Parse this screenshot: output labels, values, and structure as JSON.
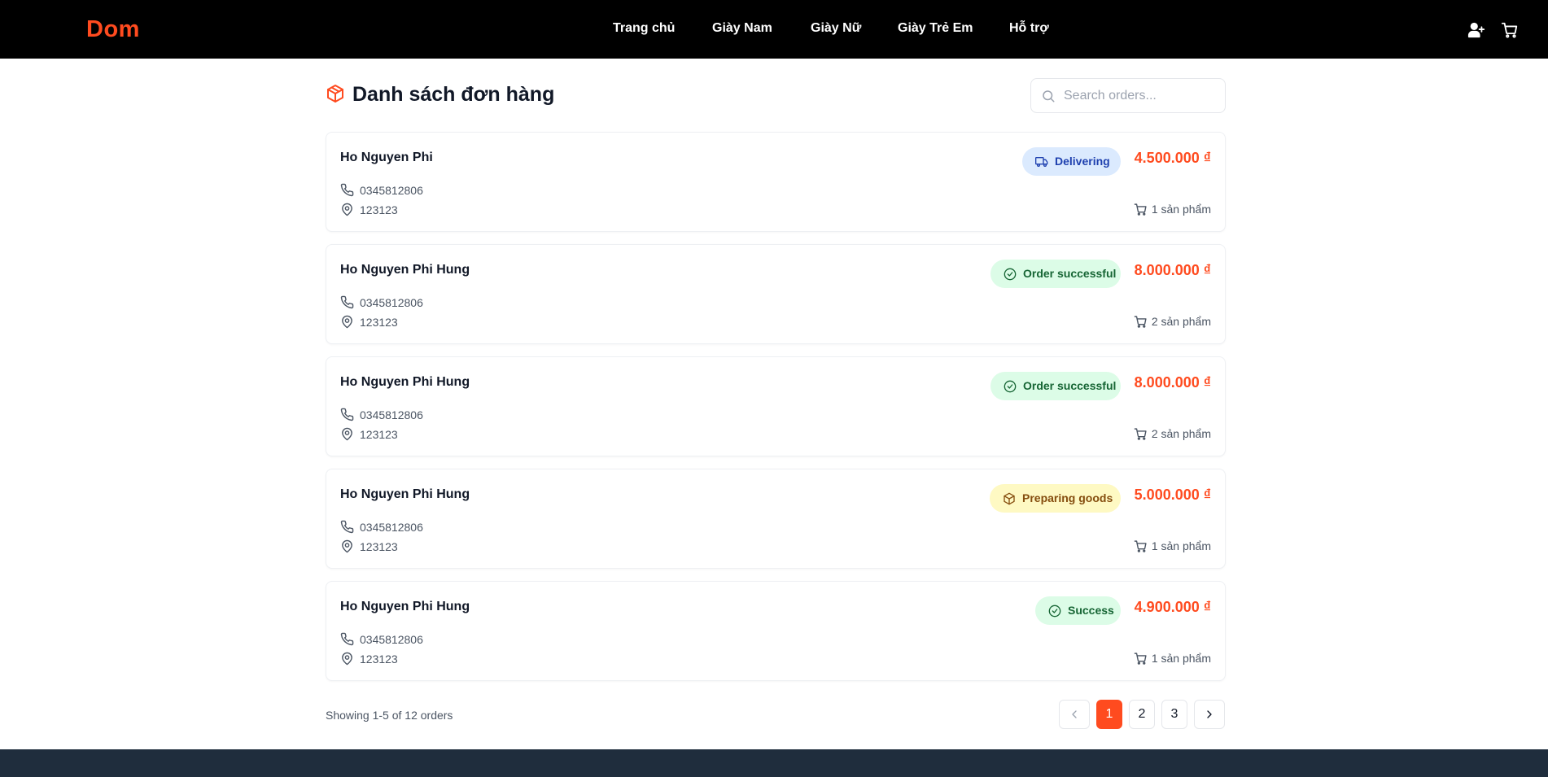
{
  "brand": {
    "logo": "Dom",
    "accent_color": "#ff4b1f"
  },
  "nav": {
    "items": [
      "Trang chủ",
      "Giày Nam",
      "Giày Nữ",
      "Giày Trẻ Em",
      "Hỗ trợ"
    ],
    "icons": [
      "user-plus-icon",
      "cart-icon"
    ]
  },
  "page": {
    "title": "Danh sách đơn hàng",
    "title_icon": "package-icon",
    "search_placeholder": "Search orders...",
    "search_value": ""
  },
  "orders": [
    {
      "name": "Ho Nguyen Phi",
      "phone": "0345812806",
      "address": "123123",
      "status": "Delivering",
      "status_icon": "truck-icon",
      "status_bg": "#dbeafe",
      "status_color": "#1e40af",
      "amount": "4.500.000 ₫",
      "items": "1 sản phẩm"
    },
    {
      "name": "Ho Nguyen Phi Hung",
      "phone": "0345812806",
      "address": "123123",
      "status": "Order successful",
      "status_icon": "check-circle-icon",
      "status_bg": "#dcfce7",
      "status_color": "#166534",
      "amount": "8.000.000 ₫",
      "items": "2 sản phẩm"
    },
    {
      "name": "Ho Nguyen Phi Hung",
      "phone": "0345812806",
      "address": "123123",
      "status": "Order successful",
      "status_icon": "check-circle-icon",
      "status_bg": "#dcfce7",
      "status_color": "#166534",
      "amount": "8.000.000 ₫",
      "items": "2 sản phẩm"
    },
    {
      "name": "Ho Nguyen Phi Hung",
      "phone": "0345812806",
      "address": "123123",
      "status": "Preparing goods",
      "status_icon": "package-icon",
      "status_bg": "#fef9c3",
      "status_color": "#854d0e",
      "amount": "5.000.000 ₫",
      "items": "1 sản phẩm"
    },
    {
      "name": "Ho Nguyen Phi Hung",
      "phone": "0345812806",
      "address": "123123",
      "status": "Success",
      "status_icon": "check-circle-icon",
      "status_bg": "#dcfce7",
      "status_color": "#166534",
      "amount": "4.900.000 ₫",
      "items": "1 sản phẩm"
    }
  ],
  "pagination": {
    "summary": "Showing 1-5 of 12 orders",
    "pages": [
      "1",
      "2",
      "3"
    ],
    "current": "1",
    "prev_icon": "chevron-left-icon",
    "next_icon": "chevron-right-icon"
  }
}
